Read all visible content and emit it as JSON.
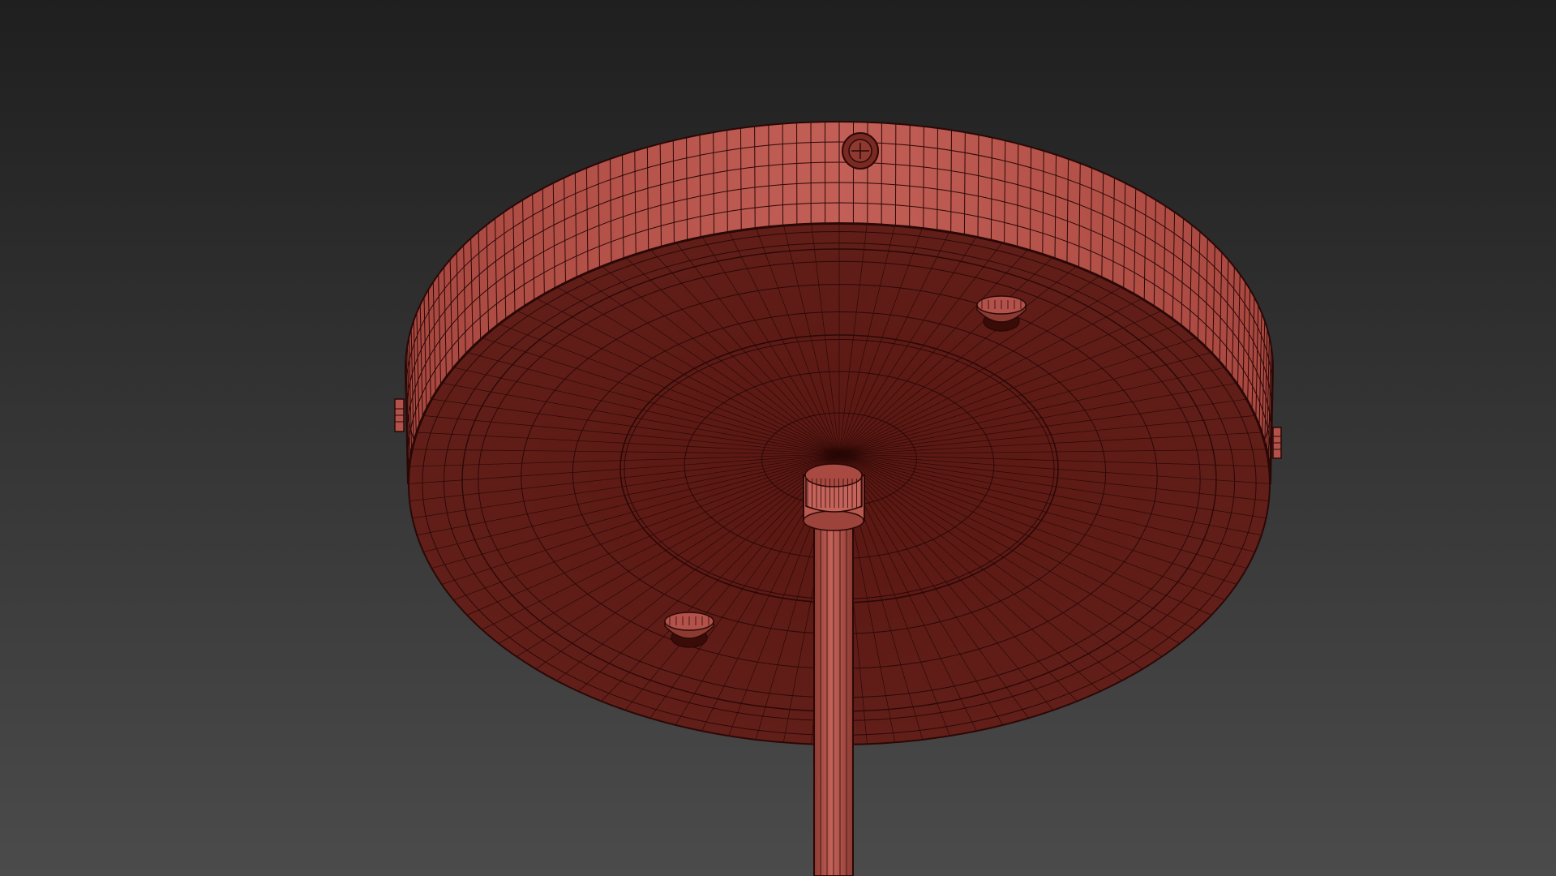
{
  "viewport": {
    "background_top": "#1f1f1f",
    "background_bottom": "#4b4b4b"
  },
  "colors": {
    "rim_face": "#b2524a",
    "rim_face_light": "#c4635a",
    "underside": "#5e1a14",
    "underside_inner": "#55140f",
    "wire": "#2a0806",
    "wire_dense": "#1f0504",
    "rod": "#b95a50",
    "rod_shadow": "#8b3a32"
  },
  "model": {
    "name_icon": "ceiling-canopy-wireframe",
    "screws": [
      "screw-top",
      "screw-right",
      "screw-left"
    ]
  }
}
